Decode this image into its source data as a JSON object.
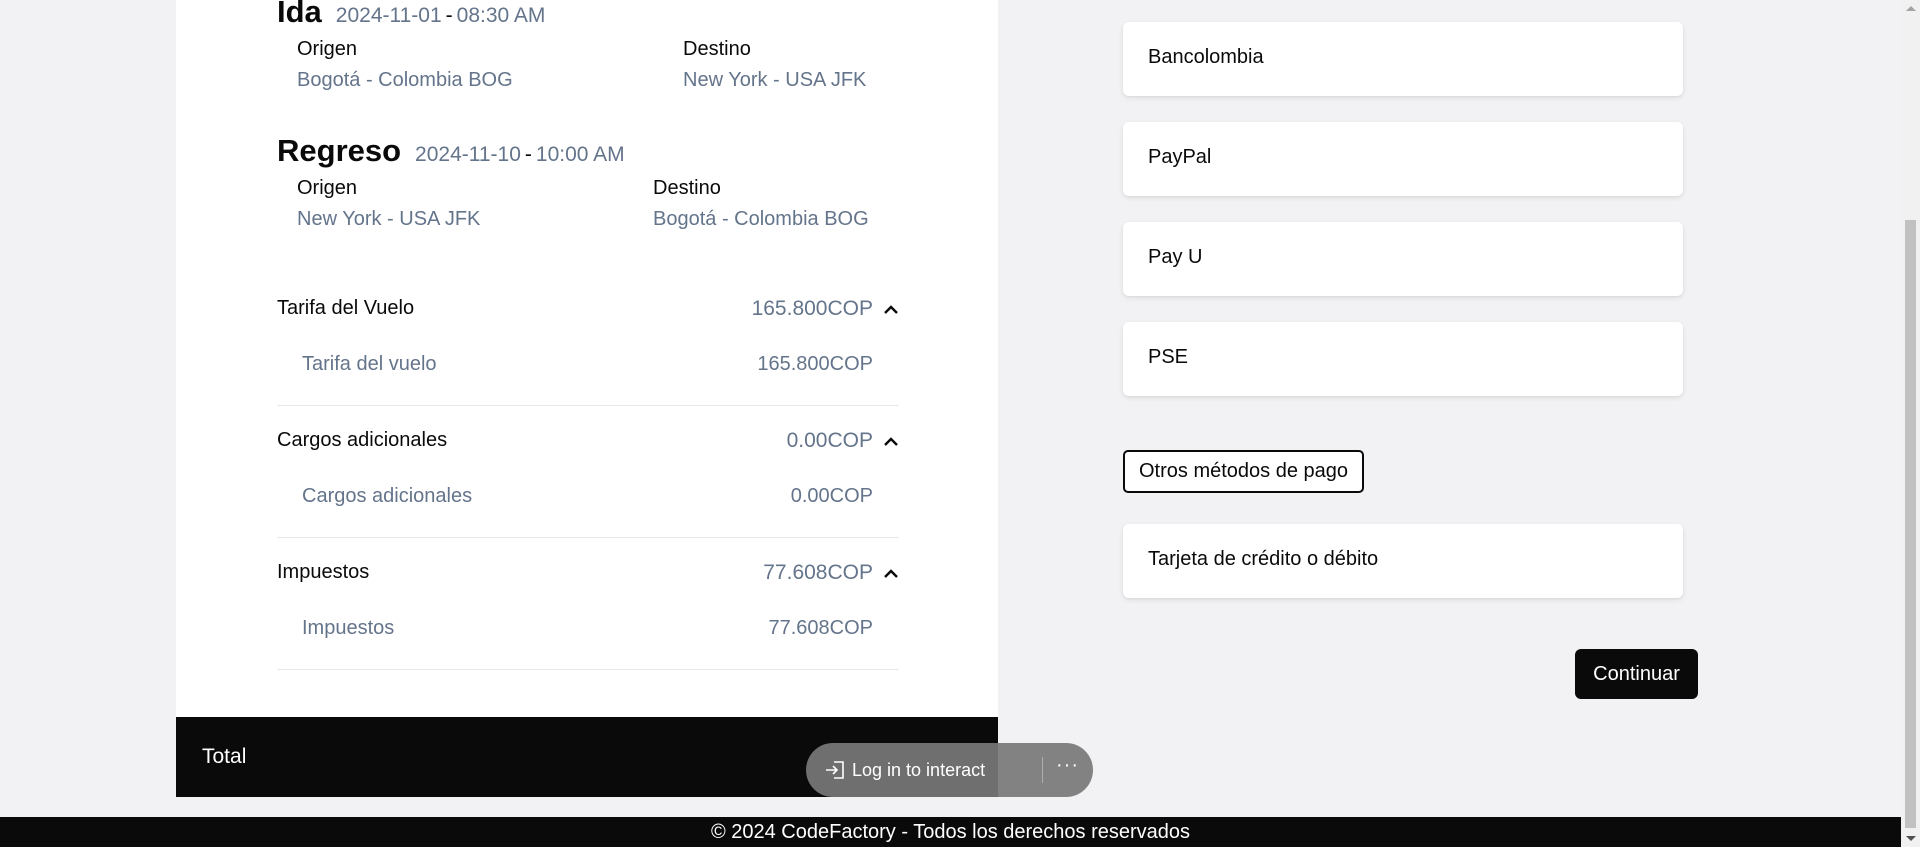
{
  "itinerary": {
    "outbound": {
      "title": "Ida",
      "date": "2024-11-01",
      "separator": "-",
      "time": "08:30 AM",
      "origin_label": "Origen",
      "origin_value": "Bogotá - Colombia BOG",
      "destination_label": "Destino",
      "destination_value": "New York - USA JFK"
    },
    "return": {
      "title": "Regreso",
      "date": "2024-11-10",
      "separator": "-",
      "time": "10:00 AM",
      "origin_label": "Origen",
      "origin_value": "New York - USA JFK",
      "destination_label": "Destino",
      "destination_value": "Bogotá - Colombia BOG"
    }
  },
  "fares": [
    {
      "name": "Tarifa del Vuelo",
      "amount": "165.800COP",
      "detail_name": "Tarifa del vuelo",
      "detail_amount": "165.800COP"
    },
    {
      "name": "Cargos adicionales",
      "amount": "0.00COP",
      "detail_name": "Cargos adicionales",
      "detail_amount": "0.00COP"
    },
    {
      "name": "Impuestos",
      "amount": "77.608COP",
      "detail_name": "Impuestos",
      "detail_amount": "77.608COP"
    }
  ],
  "total": {
    "label": "Total"
  },
  "payment_methods": [
    "Bancolombia",
    "PayPal",
    "Pay U",
    "PSE"
  ],
  "other_methods": {
    "label": "Otros métodos de pago",
    "items": [
      "Tarjeta de crédito o débito"
    ]
  },
  "continue_label": "Continuar",
  "login_pill": {
    "label": "Log in to interact",
    "more": "···"
  },
  "footer": {
    "text": "© 2024 CodeFactory - Todos los derechos reservados"
  },
  "colors": {
    "accent": "#0a0a0b",
    "muted": "#64748b",
    "background": "#f2f2f4"
  }
}
